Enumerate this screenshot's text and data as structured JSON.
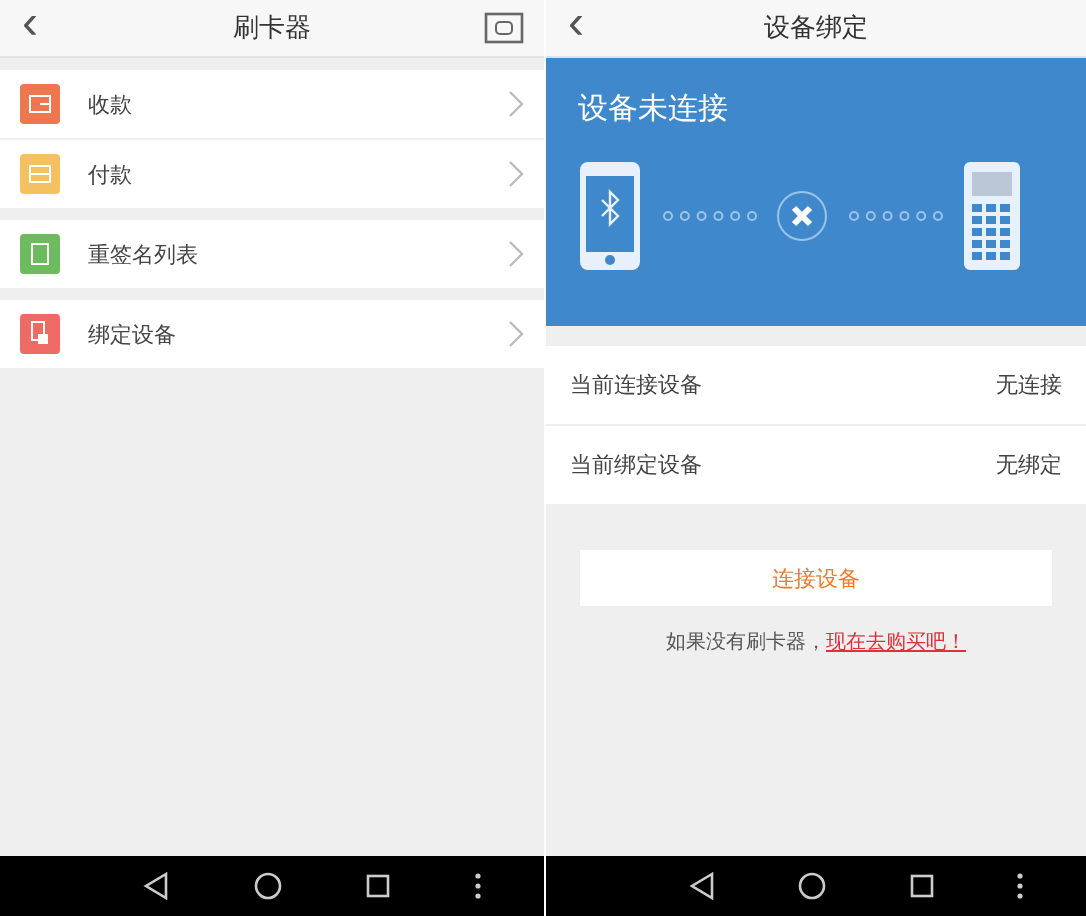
{
  "screens": [
    {
      "kind": "menu",
      "header": {
        "back": "‹",
        "title": "刷卡器"
      },
      "groups": [
        {
          "items": [
            {
              "label": "收款",
              "color": "#ee7750"
            },
            {
              "label": "付款",
              "color": "#f4c060"
            }
          ]
        },
        {
          "items": [
            {
              "label": "重签名列表",
              "color": "#6dbb5e"
            }
          ]
        },
        {
          "items": [
            {
              "label": "绑定设备",
              "color": "#ee6a64"
            }
          ]
        }
      ]
    },
    {
      "kind": "binding",
      "header": {
        "back": "‹",
        "title": "设备绑定"
      },
      "banner": {
        "title": "设备未连接",
        "connected": false
      },
      "rows": [
        {
          "label": "当前连接设备",
          "value": "无连接"
        },
        {
          "label": "当前绑定设备",
          "value": "无绑定"
        }
      ],
      "button": "连接设备",
      "hint": {
        "text": "如果没有刷卡器，",
        "link": "现在去购买吧！"
      }
    }
  ]
}
